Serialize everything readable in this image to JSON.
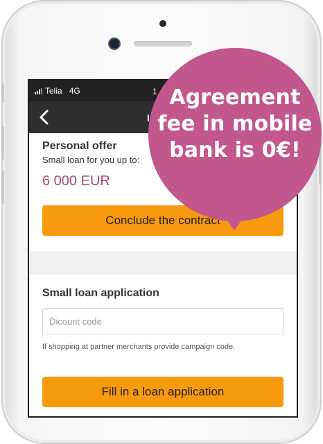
{
  "status_bar": {
    "carrier": "Telia",
    "network": "4G",
    "time": "1"
  },
  "nav": {
    "title": "I"
  },
  "offer": {
    "title": "Personal offer",
    "subtitle": "Small loan for you up to:",
    "amount": "6 000 EUR",
    "button_label": "Conclude the contract"
  },
  "application": {
    "title": "Small loan application",
    "discount_placeholder": "Dicount code",
    "discount_value": "",
    "hint": "If shopping at partner merchants provide campaign code.",
    "button_label": "Fill in a loan application"
  },
  "promo_bubble": {
    "text": "Agreement fee in mobile bank is 0€!"
  },
  "colors": {
    "accent_orange": "#f79a0e",
    "bubble_pink": "#c2578d",
    "amount_text": "#a94a73"
  }
}
